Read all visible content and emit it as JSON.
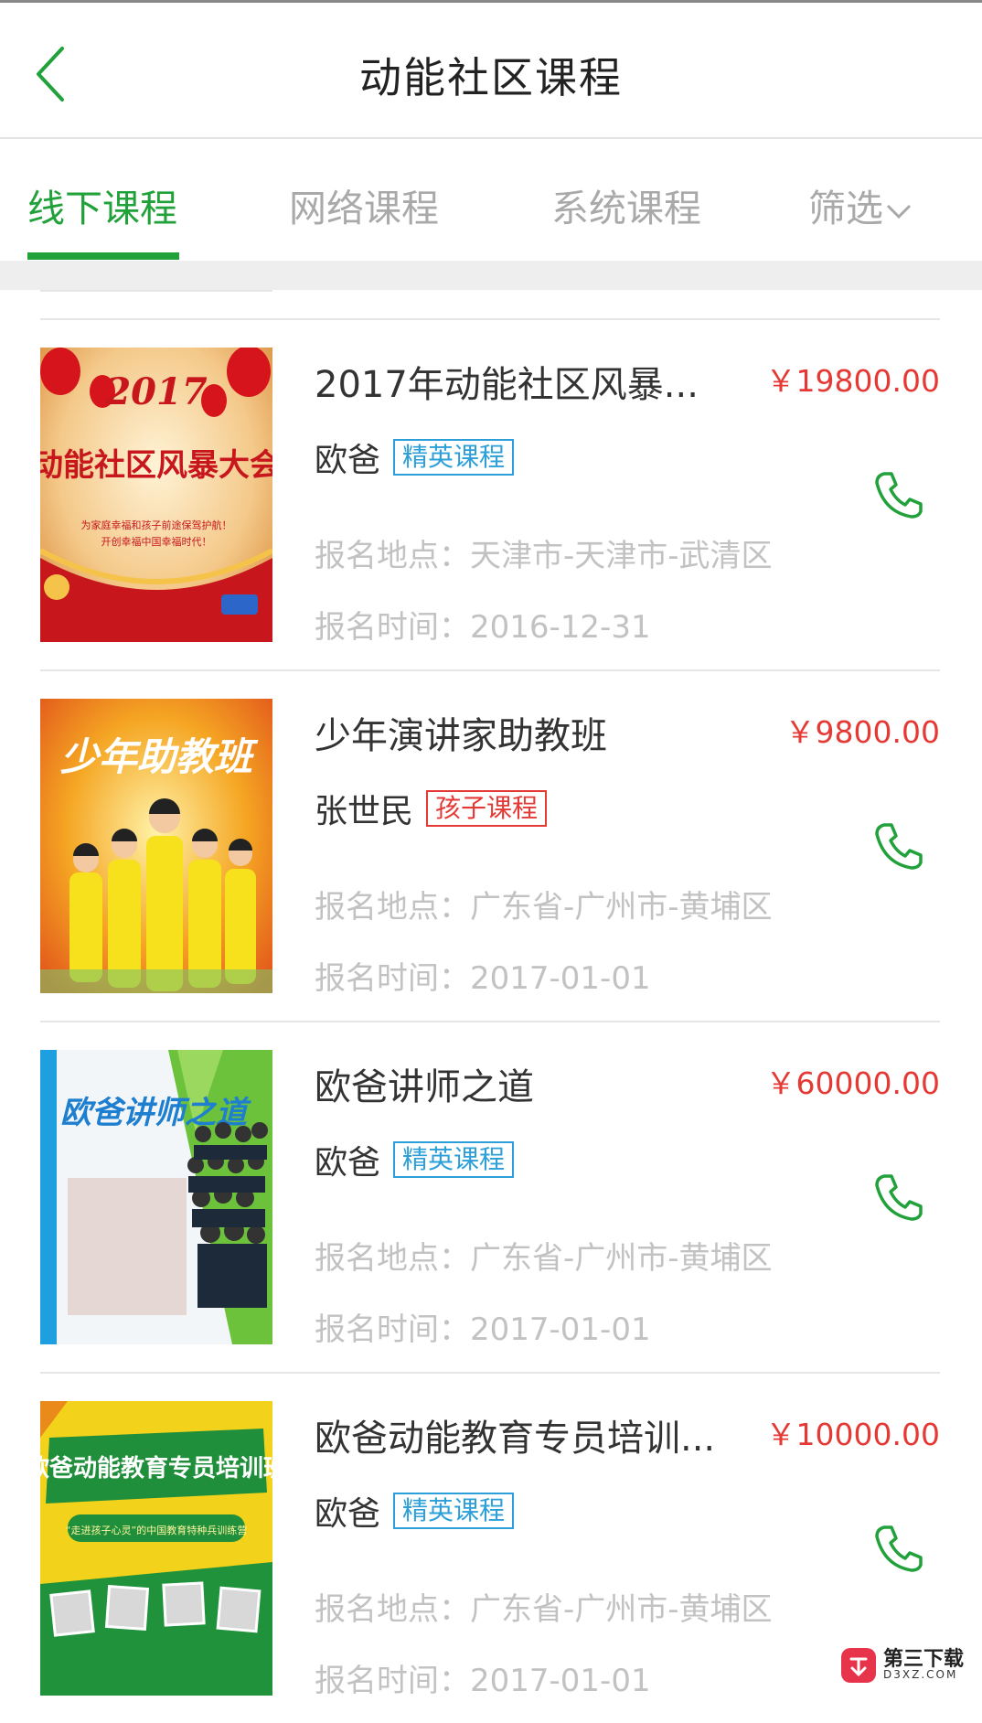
{
  "header": {
    "title": "动能社区课程"
  },
  "tabs": [
    {
      "label": "线下课程",
      "active": true
    },
    {
      "label": "网络课程",
      "active": false
    },
    {
      "label": "系统课程",
      "active": false
    },
    {
      "label": "筛选",
      "active": false
    }
  ],
  "courses": [
    {
      "title": "2017年动能社区风暴...",
      "price": "￥19800.00",
      "teacher": "欧爸",
      "badge": "精英课程",
      "badge_color": "#2c9fd9",
      "location": "报名地点：天津市-天津市-武清区",
      "time": "报名时间：2016-12-31",
      "thumb_text": [
        "2017",
        "动能社区风暴大会",
        "为家庭幸福和孩子前途保驾护航！",
        "开创幸福中国幸福时代！"
      ]
    },
    {
      "title": "少年演讲家助教班",
      "price": "￥9800.00",
      "teacher": "张世民",
      "badge": "孩子课程",
      "badge_color": "#e53935",
      "location": "报名地点：广东省-广州市-黄埔区",
      "time": "报名时间：2017-01-01",
      "thumb_text": [
        "少年助教班"
      ]
    },
    {
      "title": "欧爸讲师之道",
      "price": "￥60000.00",
      "teacher": "欧爸",
      "badge": "精英课程",
      "badge_color": "#2c9fd9",
      "location": "报名地点：广东省-广州市-黄埔区",
      "time": "报名时间：2017-01-01",
      "thumb_text": [
        "欧爸讲师之道"
      ]
    },
    {
      "title": "欧爸动能教育专员培训...",
      "price": "￥10000.00",
      "teacher": "欧爸",
      "badge": "精英课程",
      "badge_color": "#2c9fd9",
      "location": "报名地点：广东省-广州市-黄埔区",
      "time": "报名时间：2017-01-01",
      "thumb_text": [
        "欧爸动能教育专员培训班",
        "“走进孩子心灵”的中国教育特种兵训练营"
      ]
    }
  ],
  "watermark": {
    "text": "第三下载",
    "sub": "D3XZ.COM"
  },
  "colors": {
    "accent": "#21a13a",
    "price": "#e53935",
    "muted": "#c2c2c2"
  }
}
